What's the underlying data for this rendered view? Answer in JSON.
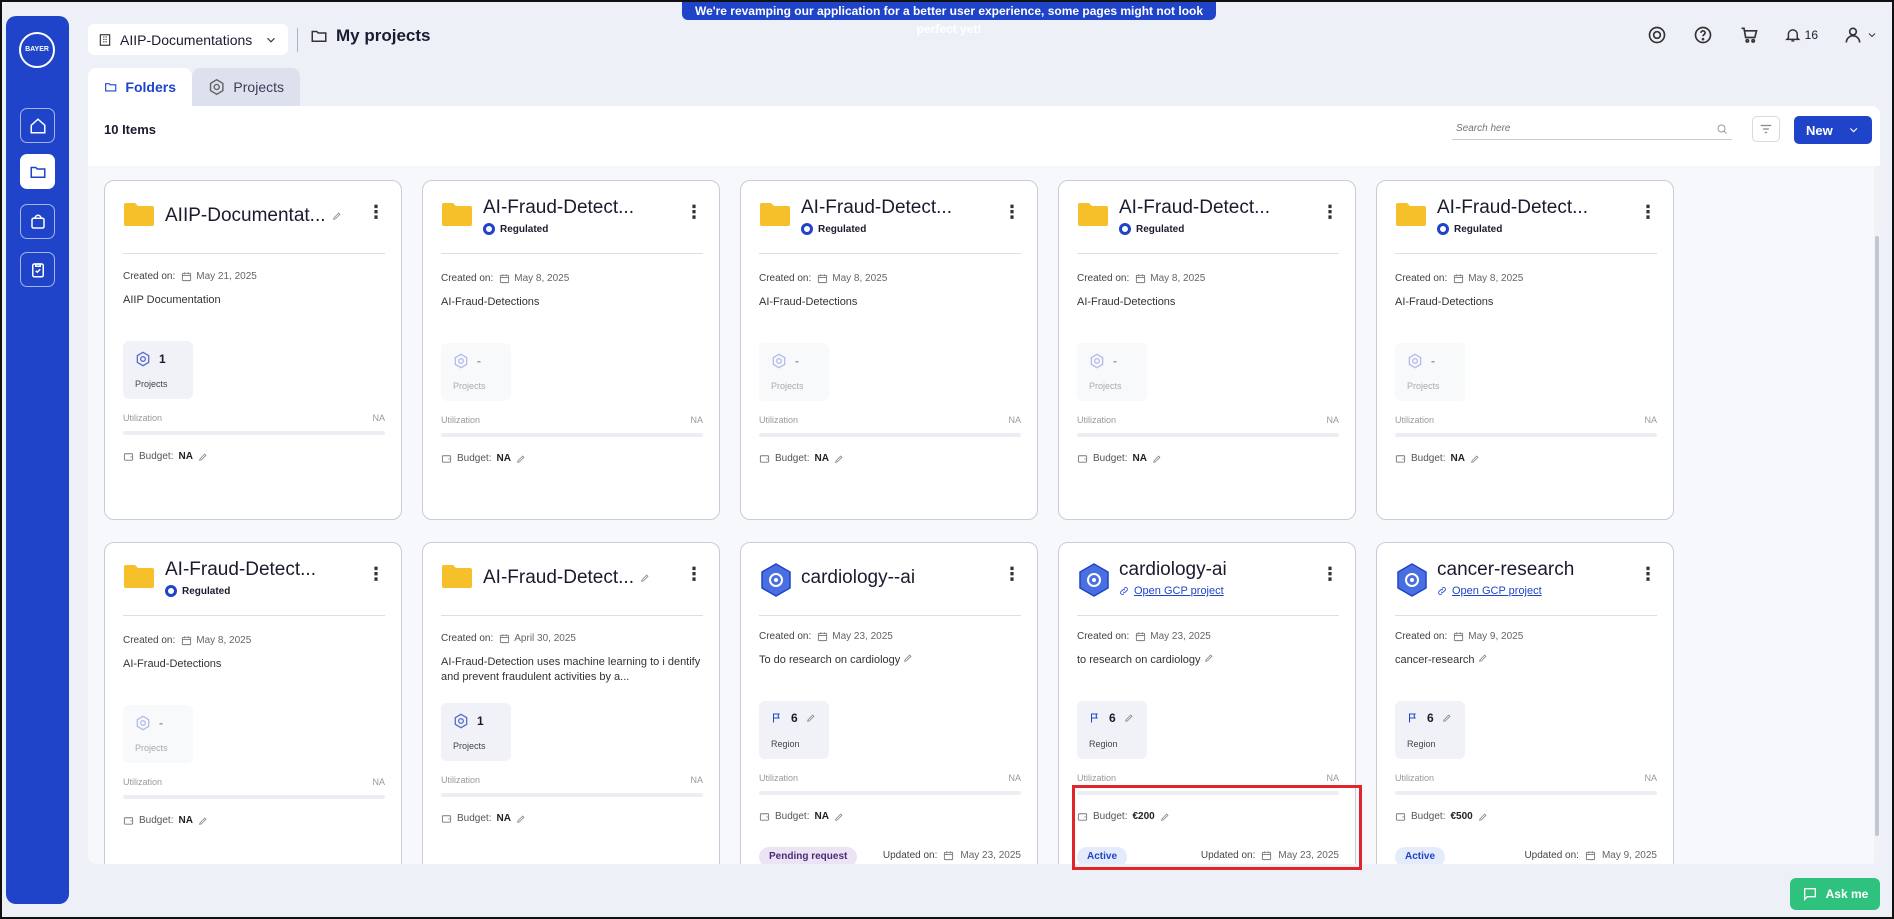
{
  "banner": "We're revamping our application for a better user experience, some pages might not look perfect yet!",
  "sidebar": {
    "logo_text": "BAYER",
    "items": [
      {
        "name": "home-icon",
        "active": false
      },
      {
        "name": "folder-icon",
        "active": true
      },
      {
        "name": "bag-icon",
        "active": false
      },
      {
        "name": "clipboard-icon",
        "active": false
      }
    ]
  },
  "header": {
    "workspace": "AIIP-Documentations",
    "page_title": "My projects",
    "notifications_count": "16"
  },
  "tabs": [
    {
      "label": "Folders",
      "active": true
    },
    {
      "label": "Projects",
      "active": false
    }
  ],
  "toolbar": {
    "items_count": "10 Items",
    "search_placeholder": "Search here",
    "new_label": "New"
  },
  "labels": {
    "created_on": "Created on:",
    "utilization": "Utilization",
    "na": "NA",
    "budget": "Budget:",
    "updated_on": "Updated on:",
    "projects": "Projects",
    "region": "Region",
    "regulated": "Regulated",
    "open_gcp": "Open GCP project"
  },
  "cards": [
    {
      "kind": "folder",
      "title": "AIIP-Documentat...",
      "title_edit": true,
      "sub": "",
      "created": "May 21, 2025",
      "desc": "AIIP Documentation",
      "tile_value": "1",
      "tile_label": "Projects",
      "tile_dim": false,
      "budget": "NA",
      "status": "",
      "updated": ""
    },
    {
      "kind": "folder",
      "title": "AI-Fraud-Detect...",
      "title_edit": false,
      "sub": "regulated",
      "created": "May 8, 2025",
      "desc": "AI-Fraud-Detections",
      "tile_value": "-",
      "tile_label": "Projects",
      "tile_dim": true,
      "budget": "NA",
      "status": "",
      "updated": ""
    },
    {
      "kind": "folder",
      "title": "AI-Fraud-Detect...",
      "title_edit": false,
      "sub": "regulated",
      "created": "May 8, 2025",
      "desc": "AI-Fraud-Detections",
      "tile_value": "-",
      "tile_label": "Projects",
      "tile_dim": true,
      "budget": "NA",
      "status": "",
      "updated": ""
    },
    {
      "kind": "folder",
      "title": "AI-Fraud-Detect...",
      "title_edit": false,
      "sub": "regulated",
      "created": "May 8, 2025",
      "desc": "AI-Fraud-Detections",
      "tile_value": "-",
      "tile_label": "Projects",
      "tile_dim": true,
      "budget": "NA",
      "status": "",
      "updated": ""
    },
    {
      "kind": "folder",
      "title": "AI-Fraud-Detect...",
      "title_edit": false,
      "sub": "regulated",
      "created": "May 8, 2025",
      "desc": "AI-Fraud-Detections",
      "tile_value": "-",
      "tile_label": "Projects",
      "tile_dim": true,
      "budget": "NA",
      "status": "",
      "updated": ""
    },
    {
      "kind": "folder",
      "title": "AI-Fraud-Detect...",
      "title_edit": false,
      "sub": "regulated",
      "created": "May 8, 2025",
      "desc": "AI-Fraud-Detections",
      "tile_value": "-",
      "tile_label": "Projects",
      "tile_dim": true,
      "budget": "NA",
      "status": "",
      "updated": ""
    },
    {
      "kind": "folder",
      "title": "AI-Fraud-Detect...",
      "title_edit": true,
      "sub": "",
      "created": "April 30, 2025",
      "desc": "AI-Fraud-Detection uses machine learning to i dentify and prevent fraudulent activities by a...",
      "tile_value": "1",
      "tile_label": "Projects",
      "tile_dim": false,
      "budget": "NA",
      "status": "",
      "updated": ""
    },
    {
      "kind": "project",
      "title": "cardiology--ai",
      "title_edit": false,
      "sub": "",
      "created": "May 23, 2025",
      "desc": "To do research on cardiology",
      "tile_value": "6",
      "tile_label": "Region",
      "tile_dim": false,
      "budget": "NA",
      "status": "Pending request",
      "updated": "May 23, 2025"
    },
    {
      "kind": "project",
      "title": "cardiology-ai",
      "title_edit": false,
      "sub": "gcp",
      "created": "May 23, 2025",
      "desc": "to research on cardiology",
      "tile_value": "6",
      "tile_label": "Region",
      "tile_dim": false,
      "budget": "€200",
      "status": "Active",
      "updated": "May 23, 2025"
    },
    {
      "kind": "project",
      "title": "cancer-research",
      "title_edit": false,
      "sub": "gcp",
      "created": "May 9, 2025",
      "desc": "cancer-research",
      "tile_value": "6",
      "tile_label": "Region",
      "tile_dim": false,
      "budget": "€500",
      "status": "Active",
      "updated": "May 9, 2025"
    }
  ],
  "ask_me": "Ask me",
  "colors": {
    "primary": "#1f44c9",
    "folder": "#f6c02a",
    "highlight": "#e1262b",
    "ask_me": "#2ec27e"
  }
}
